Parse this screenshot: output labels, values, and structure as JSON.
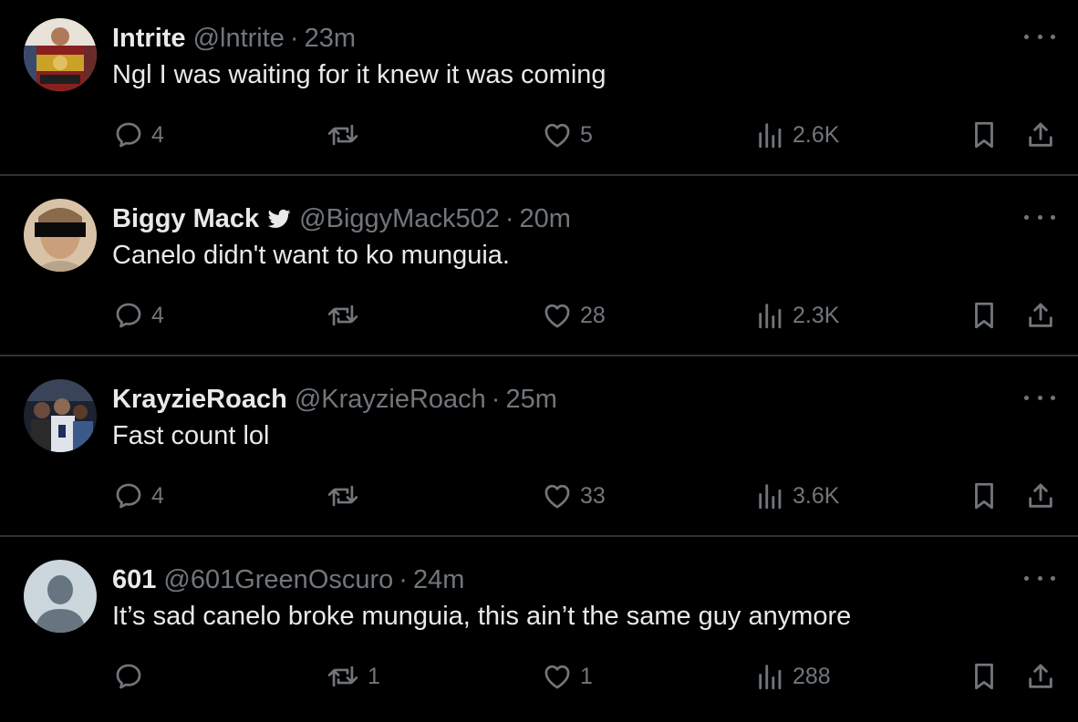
{
  "colors": {
    "background": "#000000",
    "text": "#e7e9ea",
    "muted": "#71767b",
    "divider": "#2f3336",
    "verified": "#e7e9ea"
  },
  "tweets": [
    {
      "name": "Intrite",
      "verified": false,
      "handle": "@lntrite",
      "time": "23m",
      "text": "Ngl I was waiting for it knew it was coming",
      "avatar": "boxer-with-belts-avatar",
      "replies": "4",
      "retweets": "",
      "likes": "5",
      "views": "2.6K"
    },
    {
      "name": "Biggy Mack",
      "verified": true,
      "handle": "@BiggyMack502",
      "time": "20m",
      "text": "Canelo didn't want to ko munguia.",
      "avatar": "censored-face-avatar",
      "replies": "4",
      "retweets": "",
      "likes": "28",
      "views": "2.3K"
    },
    {
      "name": "KrayzieRoach",
      "verified": false,
      "handle": "@KrayzieRoach",
      "time": "25m",
      "text": "Fast count lol",
      "avatar": "group-photo-avatar",
      "replies": "4",
      "retweets": "",
      "likes": "33",
      "views": "3.6K"
    },
    {
      "name": "601",
      "verified": false,
      "handle": "@601GreenOscuro",
      "time": "24m",
      "text": "It’s sad canelo broke munguia, this ain’t the same guy anymore",
      "avatar": "default-avatar",
      "replies": "",
      "retweets": "1",
      "likes": "1",
      "views": "288"
    }
  ]
}
